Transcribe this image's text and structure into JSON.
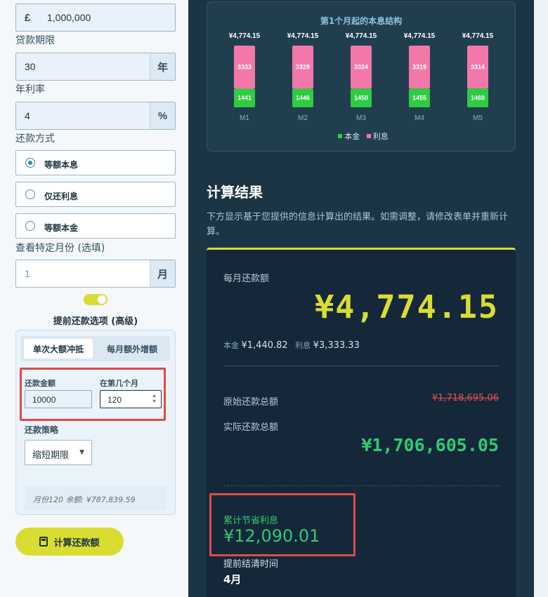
{
  "form": {
    "currency_symbol": "£",
    "loan_amount": "1,000,000",
    "term_label": "贷款期限",
    "term_value": "30",
    "term_unit": "年",
    "rate_label": "年利率",
    "rate_value": "4",
    "rate_unit": "%",
    "method_label": "还款方式",
    "methods": [
      {
        "label": "等额本息",
        "selected": true
      },
      {
        "label": "仅还利息",
        "selected": false
      },
      {
        "label": "等额本金",
        "selected": false
      }
    ],
    "specific_month_label": "查看特定月份 (选填)",
    "specific_month_placeholder": "1",
    "specific_month_unit": "月",
    "advanced_label": "提前还款选项 (高级)",
    "tabs": [
      "单次大额冲抵",
      "每月额外增额"
    ],
    "prepay_amount_label": "还款金额",
    "prepay_amount_value": "10000",
    "prepay_month_label": "在第几个月",
    "prepay_month_value": "120",
    "strategy_label": "还款策略",
    "strategy_value": "缩短期限",
    "balance_note": "月份120 余额: ¥787,839.59",
    "calc_button": "计算还款额"
  },
  "chart_data": {
    "type": "bar",
    "title": "第1个月起的本息结构",
    "categories": [
      "M1",
      "M2",
      "M3",
      "M4",
      "M5"
    ],
    "totals": [
      "¥4,774.15",
      "¥4,774.15",
      "¥4,774.15",
      "¥4,774.15",
      "¥4,774.15"
    ],
    "series": [
      {
        "name": "本金",
        "color": "#2ecc40",
        "values": [
          1441,
          1446,
          1450,
          1455,
          1460
        ]
      },
      {
        "name": "利息",
        "color": "#f178a8",
        "values": [
          3333,
          3329,
          3324,
          3319,
          3314
        ]
      }
    ],
    "stacked": true,
    "legend": "bottom"
  },
  "results": {
    "title": "计算结果",
    "description": "下方显示基于您提供的信息计算出的结果。如需调整，请修改表单并重新计算。",
    "monthly_label": "每月还款额",
    "monthly_value": "¥4,774.15",
    "principal_label": "本金",
    "principal_value": "¥1,440.82",
    "interest_label": "利息",
    "interest_value": "¥3,333.33",
    "original_total_label": "原始还款总额",
    "original_total_value": "¥1,718,695.06",
    "actual_total_label": "实际还款总额",
    "actual_total_value": "¥1,706,605.05",
    "saved_interest_label": "累计节省利息",
    "saved_interest_value": "¥12,090.01",
    "early_payoff_label": "提前结清时间",
    "early_payoff_value": "4月"
  }
}
